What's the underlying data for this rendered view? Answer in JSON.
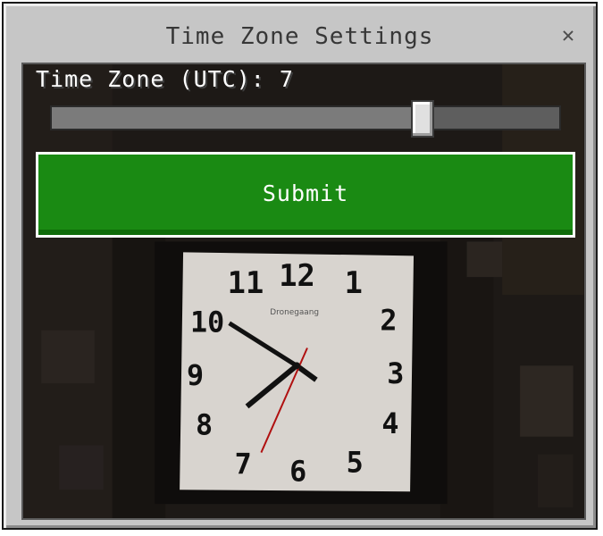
{
  "dialog": {
    "title": "Time Zone Settings",
    "close_glyph": "✕"
  },
  "slider": {
    "label": "Time Zone (UTC): 7",
    "value_fraction": 0.73
  },
  "submit": {
    "label": "Submit"
  },
  "clock": {
    "brand": "Dronegaang",
    "numbers": [
      "12",
      "1",
      "2",
      "3",
      "4",
      "5",
      "6",
      "7",
      "8",
      "9",
      "10",
      "11"
    ]
  },
  "colors": {
    "dialog_bg": "#c6c6c6",
    "button_green": "#1a8a13",
    "second_hand": "#b01010"
  }
}
